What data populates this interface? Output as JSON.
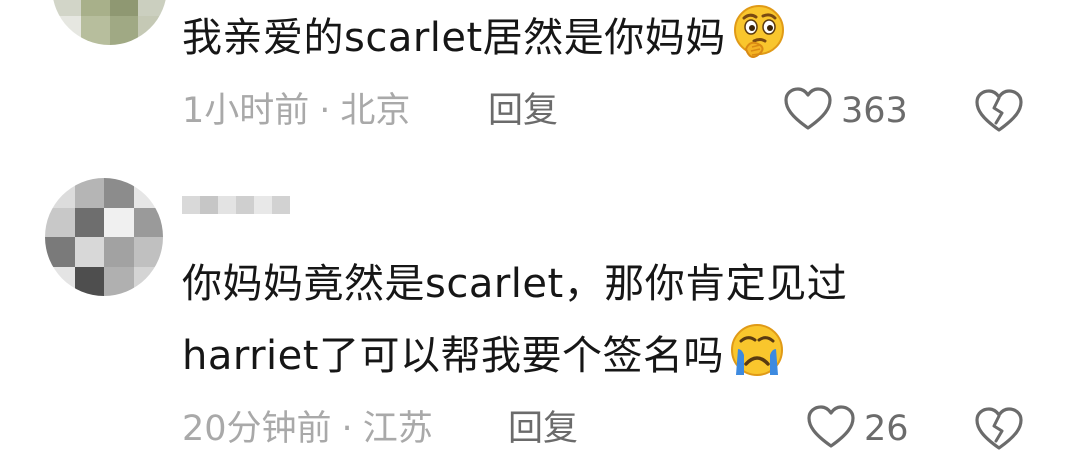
{
  "comments": [
    {
      "text": "我亲爱的scarlet居然是你妈妈",
      "emoji": "thinking-face-emoji",
      "time": "1小时前",
      "location": "北京",
      "reply_label": "回复",
      "likes": "363"
    },
    {
      "text_line1": "你妈妈竟然是scarlet，那你肯定见过",
      "text_line2": "harriet了可以帮我要个签名吗",
      "emoji": "crying-face-emoji",
      "time": "20分钟前",
      "location": "江苏",
      "reply_label": "回复",
      "likes": "26"
    }
  ],
  "separator": "·",
  "colors": {
    "text": "#161616",
    "meta": "#a9a9a9",
    "action": "#6b6b6b",
    "emoji_yellow": "#f9c62d",
    "tear_blue": "#3d8ae0"
  },
  "icons": {
    "like": "heart-outline-icon",
    "dislike": "broken-heart-icon"
  }
}
